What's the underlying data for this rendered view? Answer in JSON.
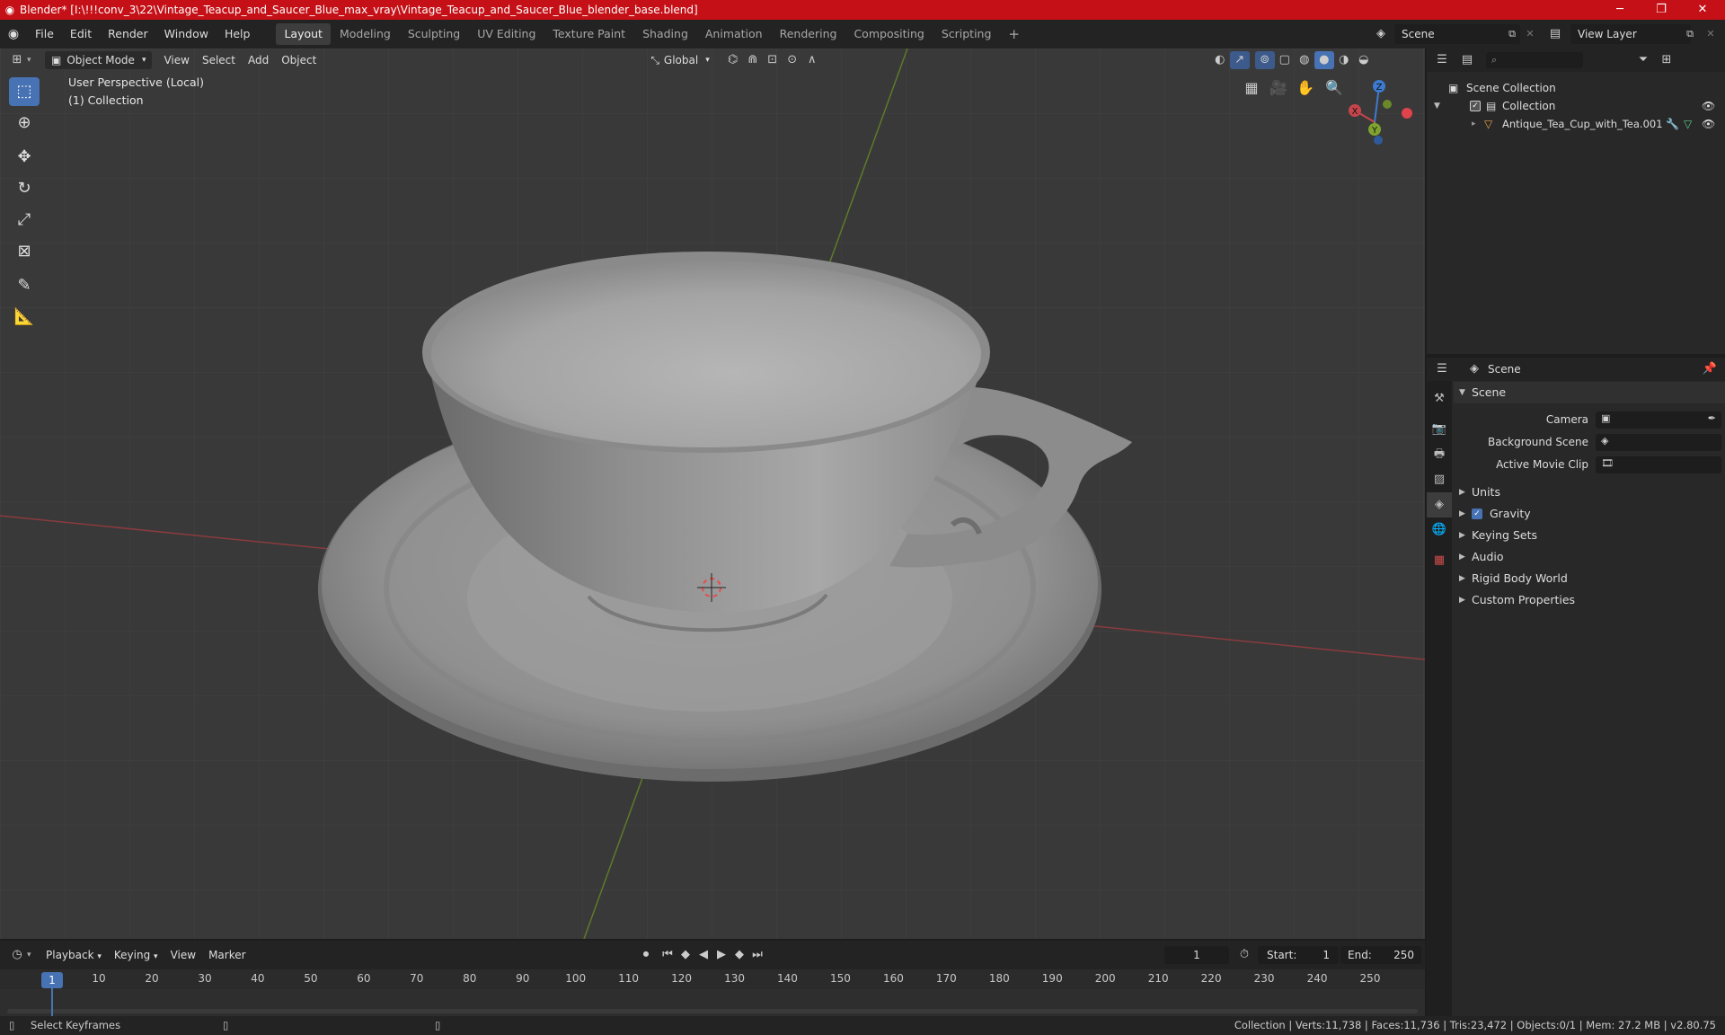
{
  "titlebar": {
    "title": "Blender* [I:\\!!!conv_3\\22\\Vintage_Teacup_and_Saucer_Blue_max_vray\\Vintage_Teacup_and_Saucer_Blue_blender_base.blend]",
    "minimize": "─",
    "maximize": "❐",
    "close": "✕"
  },
  "menu": {
    "items": [
      "File",
      "Edit",
      "Render",
      "Window",
      "Help"
    ],
    "workspaces": [
      "Layout",
      "Modeling",
      "Sculpting",
      "UV Editing",
      "Texture Paint",
      "Shading",
      "Animation",
      "Rendering",
      "Compositing",
      "Scripting"
    ],
    "add_workspace": "+",
    "scene": "Scene",
    "view_layer": "View Layer"
  },
  "viewport": {
    "mode": "Object Mode",
    "menus": [
      "View",
      "Select",
      "Add",
      "Object"
    ],
    "transform_orientation": "Global",
    "overlay_title": "User Perspective (Local)",
    "overlay_collection": "(1) Collection",
    "gizmo": {
      "x": "X",
      "y": "Y",
      "z": "Z"
    }
  },
  "outliner": {
    "search_placeholder": "",
    "scene_collection": "Scene Collection",
    "collection": "Collection",
    "object": "Antique_Tea_Cup_with_Tea.001"
  },
  "properties": {
    "header": "Scene",
    "section": "Scene",
    "rows": [
      {
        "label": "Camera"
      },
      {
        "label": "Background Scene"
      },
      {
        "label": "Active Movie Clip"
      }
    ],
    "subsections": [
      "Units",
      "Gravity",
      "Keying Sets",
      "Audio",
      "Rigid Body World",
      "Custom Properties"
    ]
  },
  "timeline": {
    "menus": [
      "Playback",
      "Keying",
      "View",
      "Marker"
    ],
    "current_frame": "1",
    "start_label": "Start:",
    "start": "1",
    "end_label": "End:",
    "end": "250",
    "ruler": [
      "1",
      "10",
      "20",
      "30",
      "40",
      "50",
      "60",
      "70",
      "80",
      "90",
      "100",
      "110",
      "120",
      "130",
      "140",
      "150",
      "160",
      "170",
      "180",
      "190",
      "200",
      "210",
      "220",
      "230",
      "240",
      "250"
    ]
  },
  "statusbar": {
    "left": "Select Keyframes",
    "right": "Collection | Verts:11,738 | Faces:11,736 | Tris:23,472 | Objects:0/1 | Mem: 27.2 MB | v2.80.75"
  },
  "colors": {
    "title_red": "#c41016",
    "accent_blue": "#4772b3",
    "x_axis": "#c6454c",
    "y_axis": "#7fa32e",
    "z_axis": "#3d7bd1"
  }
}
